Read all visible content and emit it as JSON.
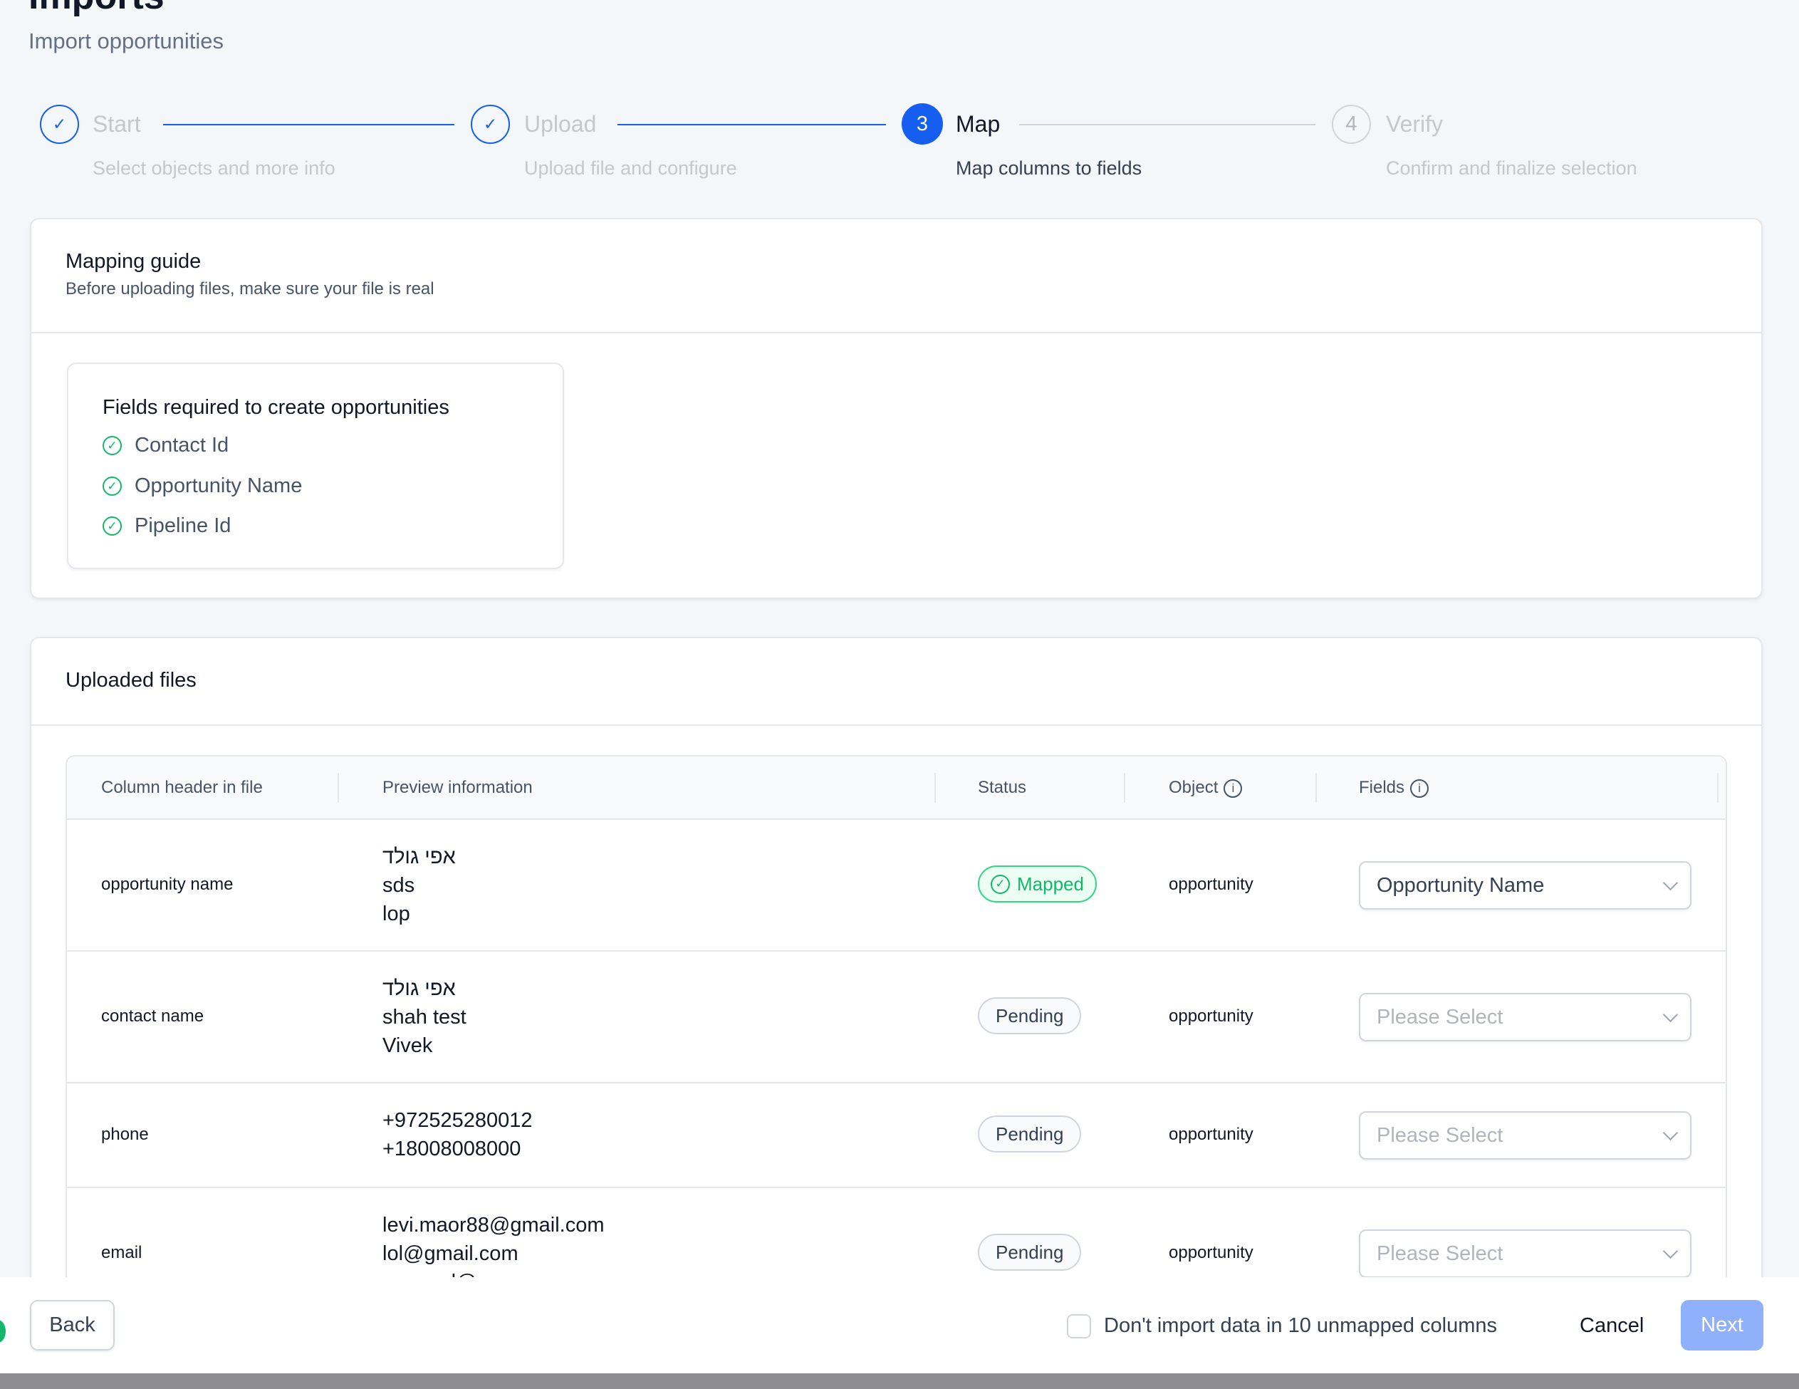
{
  "header": {
    "title": "Imports",
    "subtitle": "Import opportunities"
  },
  "steps": [
    {
      "index": "1",
      "label": "Start",
      "description": "Select objects and more info",
      "state": "completed"
    },
    {
      "index": "2",
      "label": "Upload",
      "description": "Upload file and configure",
      "state": "completed"
    },
    {
      "index": "3",
      "label": "Map",
      "description": "Map columns to fields",
      "state": "current"
    },
    {
      "index": "4",
      "label": "Verify",
      "description": "Confirm and finalize selection",
      "state": "upcoming"
    }
  ],
  "guide": {
    "title": "Mapping guide",
    "subtitle": "Before uploading files, make sure your file is real",
    "required_title": "Fields required to create opportunities",
    "required_fields": [
      "Contact Id",
      "Opportunity Name",
      "Pipeline Id"
    ]
  },
  "uploaded": {
    "title": "Uploaded files",
    "columns": [
      "Column header in file",
      "Preview information",
      "Status",
      "Object",
      "Fields"
    ],
    "rows": [
      {
        "header": "opportunity name",
        "preview": [
          "אפי גולד",
          "sds",
          "lop"
        ],
        "status": "Mapped",
        "object": "opportunity",
        "field": "Opportunity Name",
        "field_is_placeholder": false
      },
      {
        "header": "contact name",
        "preview": [
          "אפי גולד",
          "shah test",
          "Vivek"
        ],
        "status": "Pending",
        "object": "opportunity",
        "field": "Please Select",
        "field_is_placeholder": true
      },
      {
        "header": "phone",
        "preview": [
          "+972525280012",
          "+18008008000"
        ],
        "status": "Pending",
        "object": "opportunity",
        "field": "Please Select",
        "field_is_placeholder": true
      },
      {
        "header": "email",
        "preview": [
          "levi.maor88@gmail.com",
          "lol@gmail.com",
          "asosrad@mmon.com"
        ],
        "status": "Pending",
        "object": "opportunity",
        "field": "Please Select",
        "field_is_placeholder": true
      }
    ]
  },
  "footer": {
    "back": "Back",
    "checkbox_label": "Don't import data in 10 unmapped columns",
    "checkbox_checked": false,
    "cancel": "Cancel",
    "next": "Next"
  },
  "colors": {
    "accent": "#155eef",
    "success": "#12b76a",
    "next_disabled": "#8fb0fb"
  }
}
